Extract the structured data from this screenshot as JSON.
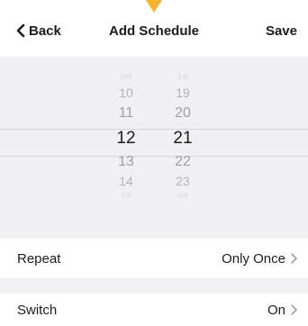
{
  "nav": {
    "back_label": "Back",
    "title": "Add Schedule",
    "save_label": "Save",
    "marker_color": "#f4b431"
  },
  "picker": {
    "hours": [
      "09",
      "10",
      "11",
      "12",
      "13",
      "14",
      "15"
    ],
    "minutes": [
      "18",
      "19",
      "20",
      "21",
      "22",
      "23",
      "24"
    ],
    "selected_hour": "12",
    "selected_minute": "21"
  },
  "settings": {
    "repeat": {
      "label": "Repeat",
      "value": "Only Once"
    },
    "switch": {
      "label": "Switch",
      "value": "On"
    }
  },
  "icons": {
    "back": "chevron-left-icon",
    "disclosure": "chevron-right-icon"
  }
}
